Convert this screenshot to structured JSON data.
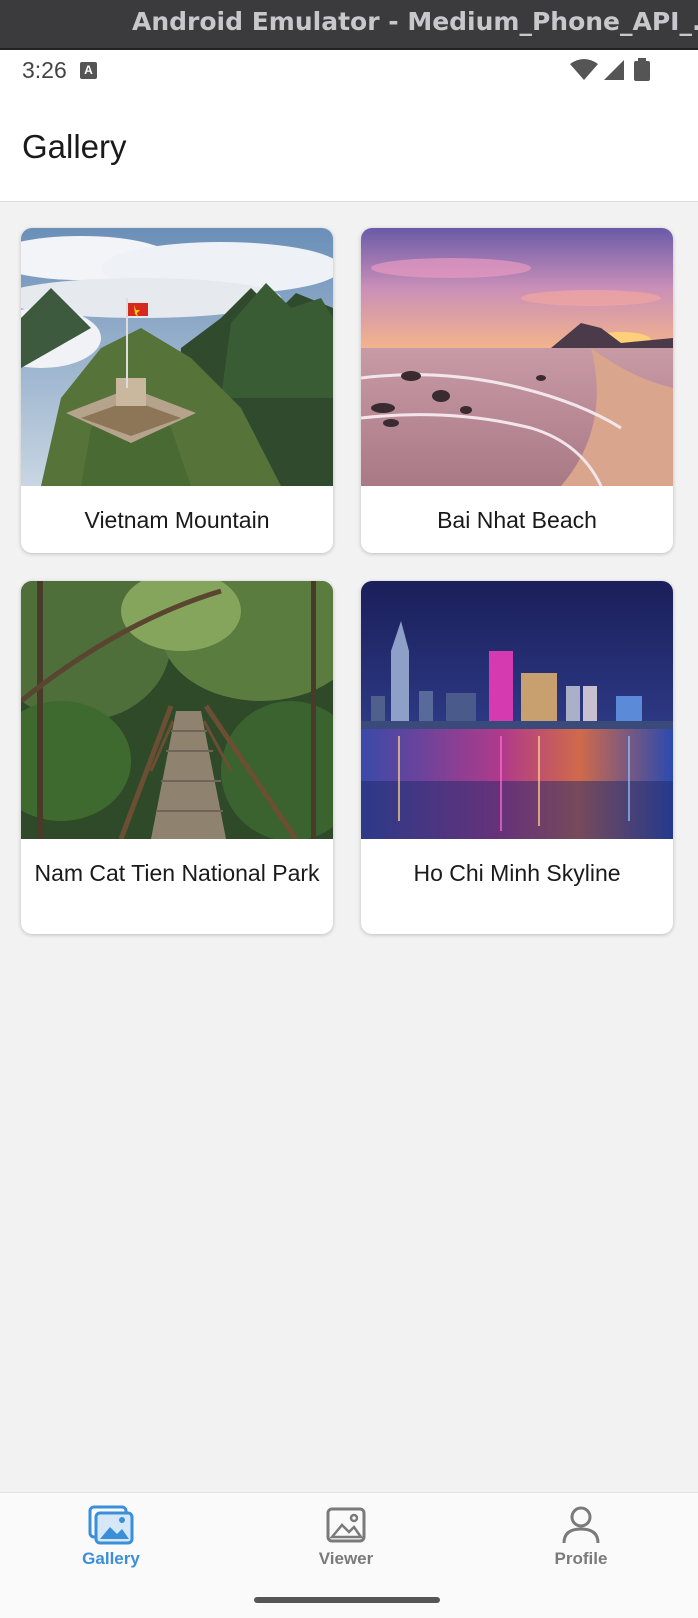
{
  "window": {
    "title": "Android Emulator - Medium_Phone_API_..."
  },
  "statusbar": {
    "time": "3:26",
    "notification_icon": "A"
  },
  "appbar": {
    "title": "Gallery"
  },
  "gallery": {
    "items": [
      {
        "title": "Vietnam Mountain",
        "image": "mountain-photo"
      },
      {
        "title": "Bai Nhat Beach",
        "image": "beach-photo"
      },
      {
        "title": "Nam Cat Tien National Park",
        "image": "forest-photo"
      },
      {
        "title": "Ho Chi Minh Skyline",
        "image": "skyline-photo"
      }
    ]
  },
  "bottom_nav": {
    "active_color": "#3b8fd9",
    "inactive_color": "#7a7a7a",
    "items": [
      {
        "label": "Gallery",
        "icon": "gallery-icon",
        "active": true
      },
      {
        "label": "Viewer",
        "icon": "image-icon",
        "active": false
      },
      {
        "label": "Profile",
        "icon": "person-icon",
        "active": false
      }
    ]
  }
}
